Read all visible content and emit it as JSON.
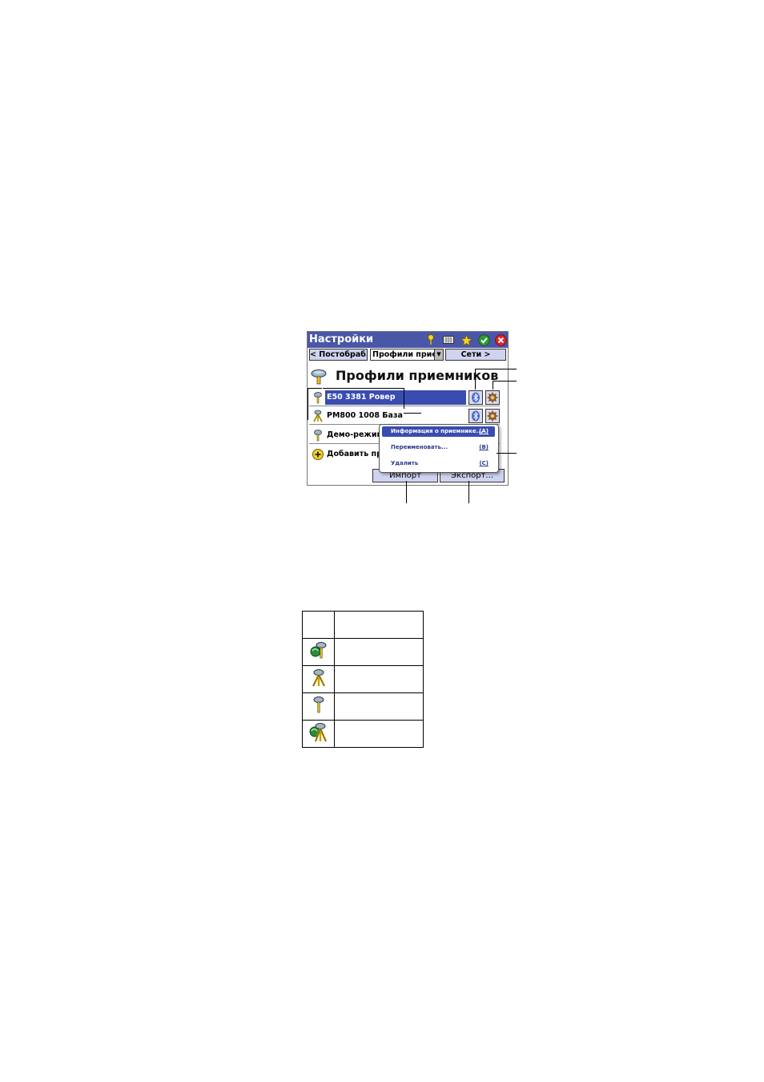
{
  "window": {
    "title": "Настройки"
  },
  "toolbar_icons": [
    "help-icon",
    "keyboard-icon",
    "star-icon",
    "ok-icon",
    "close-icon"
  ],
  "nav": {
    "back_label": "< Постобраб.",
    "select_value": "Профили прием",
    "forward_label": "Сети >"
  },
  "page": {
    "heading": "Профили приемников"
  },
  "profiles": [
    {
      "label": "E50 3381 Ровер",
      "icon": "rover-antenna-icon",
      "selected": true
    },
    {
      "label": "PM800 1008 База",
      "icon": "base-tripod-icon",
      "selected": false
    },
    {
      "label": "Демо-режим",
      "icon": "rover-antenna-icon",
      "selected": false
    },
    {
      "label": "Добавить про",
      "icon": "add-icon",
      "selected": false
    }
  ],
  "buttons": {
    "import_label": "Импорт",
    "export_label": "Экспорт..."
  },
  "context_menu": [
    {
      "label": "Информация о приемнике...",
      "key": "(A)",
      "active": true
    },
    {
      "label": "Переименовать...",
      "key": "(B)",
      "active": false
    },
    {
      "label": "Удалить",
      "key": "(C)",
      "active": false
    }
  ],
  "legend_icons": [
    "connected-rover-icon",
    "base-tripod-icon",
    "rover-antenna-icon",
    "connected-base-icon"
  ],
  "colors": {
    "titlebar": "#4a57a8",
    "selection": "#3a4cb0",
    "button": "#cfd3f0"
  }
}
